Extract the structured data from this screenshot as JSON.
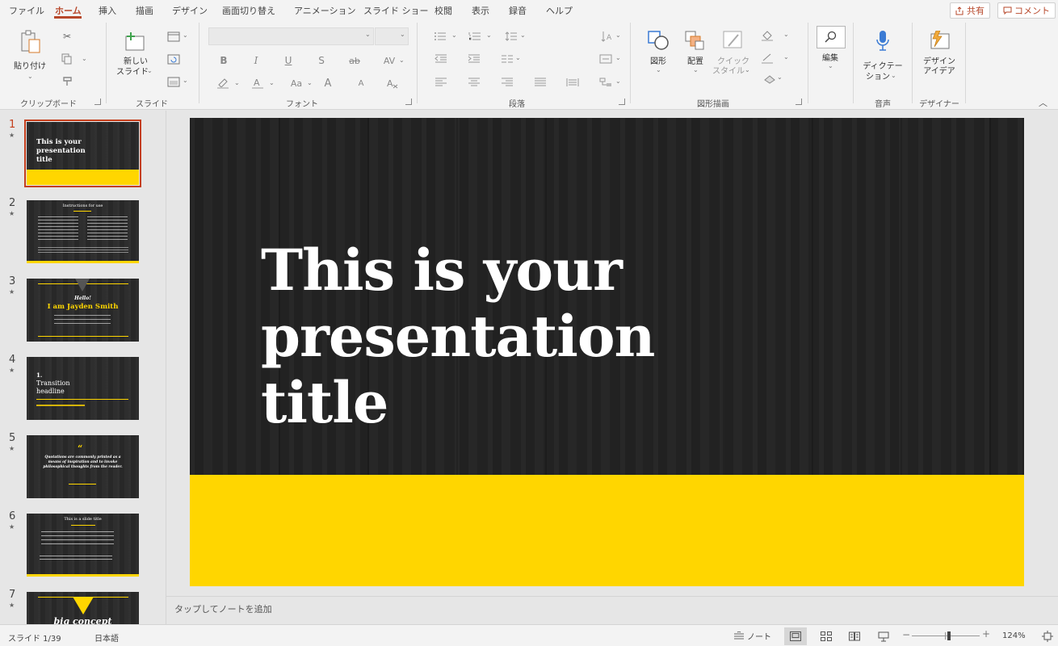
{
  "menu": {
    "tabs": [
      "ファイル",
      "ホーム",
      "挿入",
      "描画",
      "デザイン",
      "画面切り替え",
      "アニメーション",
      "スライド ショー",
      "校閲",
      "表示",
      "録音",
      "ヘルプ"
    ],
    "active_tab": "ホーム",
    "share_label": "共有",
    "comment_label": "コメント"
  },
  "ribbon": {
    "groups": {
      "clipboard": "クリップボード",
      "slides": "スライド",
      "font": "フォント",
      "paragraph": "段落",
      "drawing": "図形描画",
      "voice": "音声",
      "designer": "デザイナー"
    },
    "paste_label": "貼り付け",
    "new_slide_label_1": "新しい",
    "new_slide_label_2": "スライド",
    "shapes_label": "図形",
    "arrange_label": "配置",
    "quick_styles_label_1": "クイック",
    "quick_styles_label_2": "スタイル",
    "edit_label": "編集",
    "dictate_label_1": "ディクテー",
    "dictate_label_2": "ション",
    "design_ideas_label_1": "デザイン",
    "design_ideas_label_2": "アイデア",
    "font_buttons": [
      "B",
      "I",
      "U",
      "S",
      "ab",
      "AV"
    ],
    "font_size_buttons": [
      "Aa",
      "A",
      "A"
    ]
  },
  "thumbnails": [
    {
      "number": "1",
      "title": "This is your presentation title"
    },
    {
      "number": "2",
      "title": "Instructions for use"
    },
    {
      "number": "3",
      "hello": "Hello!",
      "title": "I am Jayden Smith"
    },
    {
      "number": "4",
      "num": "1.",
      "title": "Transition headline"
    },
    {
      "number": "5",
      "quote": "Quotations are commonly printed as a means of inspiration and to invoke philosophical thoughts from the reader."
    },
    {
      "number": "6",
      "title": "This is a slide title"
    },
    {
      "number": "7",
      "title": "big concept"
    }
  ],
  "slide": {
    "title": "This is your presentation title"
  },
  "notes": {
    "placeholder": "タップしてノートを追加"
  },
  "status": {
    "slide_indicator": "スライド 1/39",
    "language": "日本語",
    "notes_button": "ノート",
    "zoom": "124%"
  },
  "colors": {
    "accent": "#b7472a",
    "slide_band": "#ffd600",
    "slide_bg": "#232323"
  }
}
